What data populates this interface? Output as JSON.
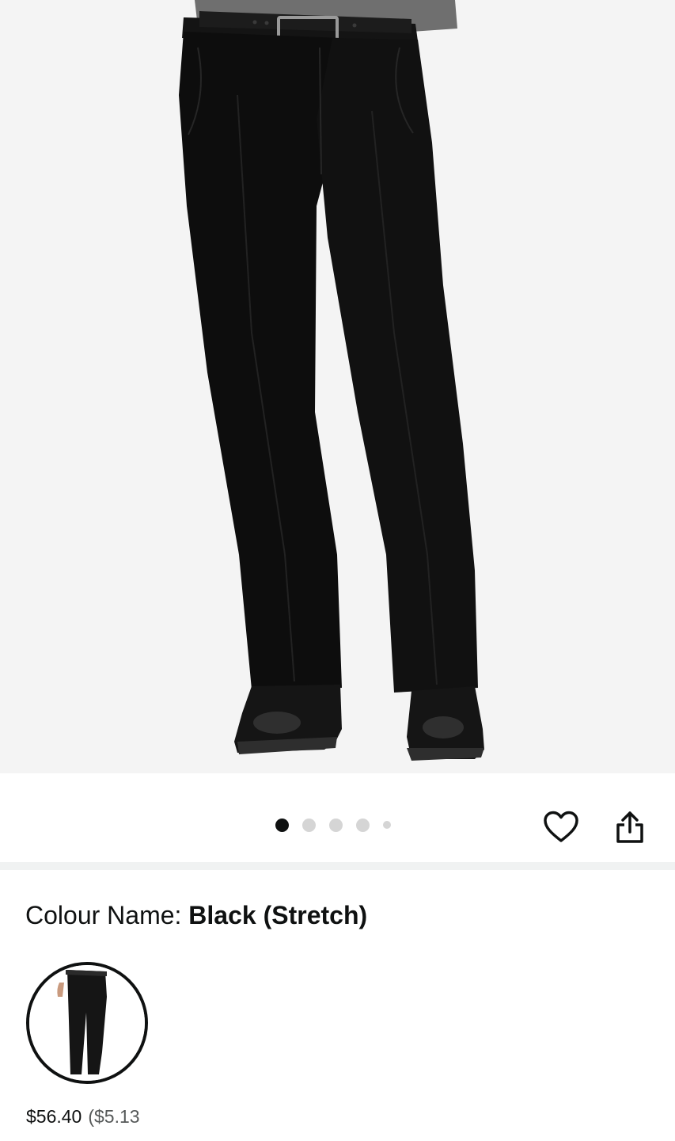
{
  "gallery": {
    "image_count": 5,
    "active_index": 0
  },
  "actions": {
    "wishlist_icon": "heart-icon",
    "share_icon": "share-icon"
  },
  "colour": {
    "label": "Colour Name: ",
    "value": "Black (Stretch)"
  },
  "swatch": {
    "price": "$56.40",
    "unit_price": "($5.13"
  },
  "colors": {
    "text": "#0f1111",
    "secondary_text": "#565959",
    "dot_active": "#0f1111",
    "dot_inactive": "#d5d5d5",
    "hero_background": "#f4f4f4"
  }
}
